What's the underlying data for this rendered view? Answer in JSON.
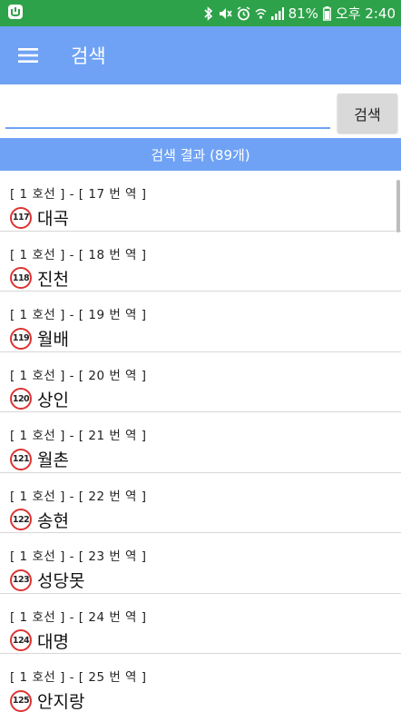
{
  "status_bar": {
    "battery": "81%",
    "time": "오후 2:40",
    "icons": [
      "app-notification-icon",
      "bluetooth-icon",
      "mute-icon",
      "alarm-icon",
      "wifi-icon",
      "signal-icon",
      "battery-icon"
    ]
  },
  "app_bar": {
    "title": "검색",
    "menu_icon": "hamburger-menu-icon"
  },
  "search": {
    "value": "",
    "placeholder": "",
    "button_label": "검색"
  },
  "results": {
    "header": "검색 결과 (89개)",
    "items": [
      {
        "meta": "[ 1 호선 ] - [ 17 번 역 ]",
        "badge": "117",
        "name": "대곡"
      },
      {
        "meta": "[ 1 호선 ] - [ 18 번 역 ]",
        "badge": "118",
        "name": "진천"
      },
      {
        "meta": "[ 1 호선 ] - [ 19 번 역 ]",
        "badge": "119",
        "name": "월배"
      },
      {
        "meta": "[ 1 호선 ] - [ 20 번 역 ]",
        "badge": "120",
        "name": "상인"
      },
      {
        "meta": "[ 1 호선 ] - [ 21 번 역 ]",
        "badge": "121",
        "name": "월촌"
      },
      {
        "meta": "[ 1 호선 ] - [ 22 번 역 ]",
        "badge": "122",
        "name": "송현"
      },
      {
        "meta": "[ 1 호선 ] - [ 23 번 역 ]",
        "badge": "123",
        "name": "성당못"
      },
      {
        "meta": "[ 1 호선 ] - [ 24 번 역 ]",
        "badge": "124",
        "name": "대명"
      },
      {
        "meta": "[ 1 호선 ] - [ 25 번 역 ]",
        "badge": "125",
        "name": "안지랑"
      }
    ]
  },
  "colors": {
    "status_bar": "#2ea24a",
    "primary": "#6fa2f5",
    "badge_ring": "#dd3333"
  }
}
